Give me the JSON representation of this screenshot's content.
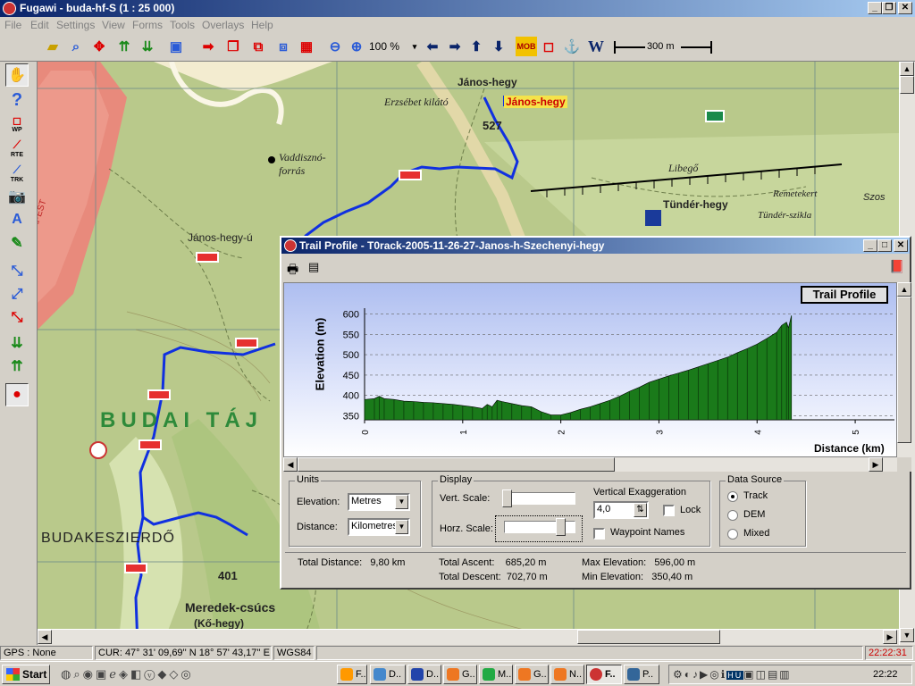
{
  "app": {
    "title": "Fugawi - buda-hf-S  (1 : 25 000)",
    "menu": [
      "File",
      "Edit",
      "Settings",
      "View",
      "Forms",
      "Tools",
      "Overlays",
      "Help"
    ]
  },
  "toolbar": {
    "zoom_value": "100 %",
    "scale_label": "300 m",
    "icons": [
      "open-icon",
      "find-icon",
      "pan-icon",
      "import-icon",
      "export-icon",
      "monitor-icon",
      "goto-icon",
      "route-icon",
      "track-icon",
      "waypoint-icon",
      "layers-icon",
      "zoom-out-icon",
      "zoom-in-icon",
      "arrow-left-icon",
      "arrow-right-icon",
      "arrow-up-icon",
      "arrow-down-icon",
      "mob-icon",
      "mark-icon",
      "anchor-icon",
      "w-icon"
    ]
  },
  "left_toolbar": {
    "labels": {
      "wp": "WP",
      "rte": "RTE",
      "trk": "TRK"
    }
  },
  "map": {
    "labels": [
      {
        "name": "János-hegy"
      },
      {
        "name": "János-hegy highlighted",
        "text": "János-hegy"
      },
      {
        "name": "Erzsébet-kilátó",
        "text": "Erzsébet kilátó"
      },
      {
        "name": "peak-527",
        "text": "527"
      },
      {
        "name": "Vaddisznó-forrás",
        "text": "Vaddisznó-forrás"
      },
      {
        "name": "Libegő",
        "text": "Libegő"
      },
      {
        "name": "Tündér-hegy",
        "text": "Tündér-hegy"
      },
      {
        "name": "Remetekert",
        "text": "Remetekert"
      },
      {
        "name": "Tündér-szikla",
        "text": "Tündér-szikla"
      },
      {
        "name": "Szoso",
        "text": "Szos"
      },
      {
        "name": "Janos-hegy-ut",
        "text": "János-hegy-ú"
      },
      {
        "name": "Budapest",
        "text": "BUDAPEST"
      },
      {
        "name": "Budai-taj",
        "text": "BUDAI TÁJ"
      },
      {
        "name": "Budakeszierdo",
        "text": "BUDAKESZIERDŐ"
      },
      {
        "name": "peak-401",
        "text": "401"
      },
      {
        "name": "Meredek-csucs",
        "text": "Meredek-csúcs"
      },
      {
        "name": "Ko-hegy",
        "text": "(Kő-hegy)"
      }
    ]
  },
  "dialog": {
    "title": "Trail Profile - T0rack-2005-11-26-27-Janos-h-Szechenyi-hegy",
    "chart_badge": "Trail Profile",
    "units": {
      "label": "Units",
      "elevation_label": "Elevation:",
      "elevation_value": "Metres",
      "distance_label": "Distance:",
      "distance_value": "Kilometres"
    },
    "display": {
      "label": "Display",
      "vert_scale_label": "Vert. Scale:",
      "horz_scale_label": "Horz. Scale:",
      "vert_exag_label": "Vertical Exaggeration",
      "vert_exag_value": "4,0",
      "lock_label": "Lock",
      "waypoint_names_label": "Waypoint Names"
    },
    "data_source": {
      "label": "Data Source",
      "options": [
        "Track",
        "DEM",
        "Mixed"
      ],
      "selected": "Track"
    },
    "stats": {
      "total_distance": "Total Distance:   9,80 km",
      "total_ascent": "Total Ascent:    685,20 m",
      "total_descent": "Total Descent:  702,70 m",
      "max_elevation": "Max Elevation:   596,00 m",
      "min_elevation": "Min Elevation:   350,40 m"
    }
  },
  "chart_data": {
    "type": "area",
    "xlabel": "Distance (km)",
    "ylabel": "Elevation (m)",
    "xlim": [
      0,
      5.4
    ],
    "ylim": [
      340,
      610
    ],
    "x_ticks": [
      0,
      1,
      2,
      3,
      4,
      5
    ],
    "y_ticks": [
      350,
      400,
      450,
      500,
      550,
      600
    ],
    "grid": true,
    "color": "#1a7a1a",
    "x": [
      0,
      0.1,
      0.15,
      0.2,
      0.3,
      0.4,
      0.5,
      0.6,
      0.7,
      0.8,
      0.9,
      1.0,
      1.1,
      1.2,
      1.25,
      1.3,
      1.35,
      1.4,
      1.5,
      1.6,
      1.7,
      1.8,
      1.9,
      2.0,
      2.1,
      2.2,
      2.3,
      2.4,
      2.5,
      2.6,
      2.7,
      2.8,
      2.9,
      3.0,
      3.1,
      3.2,
      3.3,
      3.4,
      3.5,
      3.6,
      3.7,
      3.8,
      3.9,
      4.0,
      4.1,
      4.2,
      4.25,
      4.3,
      4.32,
      4.35
    ],
    "y": [
      390,
      392,
      398,
      392,
      390,
      386,
      385,
      383,
      382,
      380,
      378,
      375,
      372,
      368,
      378,
      372,
      388,
      385,
      380,
      375,
      372,
      360,
      352,
      352,
      358,
      366,
      372,
      380,
      388,
      398,
      410,
      420,
      432,
      440,
      448,
      455,
      462,
      470,
      478,
      486,
      494,
      505,
      515,
      526,
      540,
      555,
      572,
      580,
      566,
      596
    ]
  },
  "status": {
    "gps": "GPS : None",
    "cursor": "CUR: 47° 31' 09,69'' N 18° 57' 43,17'' E",
    "datum": "WGS84",
    "time": "22:22:31"
  },
  "taskbar": {
    "start": "Start",
    "tasks": [
      "F..",
      "D..",
      "D..",
      "G..",
      "M..",
      "G..",
      "N..",
      "F..",
      "P.."
    ],
    "clock": "22:22"
  }
}
